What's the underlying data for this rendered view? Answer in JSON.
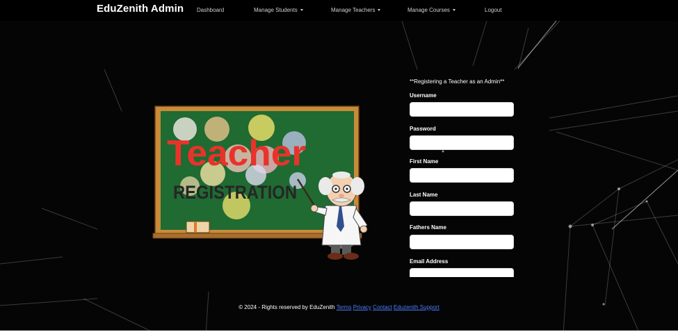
{
  "navbar": {
    "brand": "EduZenith Admin",
    "items": [
      {
        "label": "Dashboard",
        "dropdown": false
      },
      {
        "label": "Manage Students",
        "dropdown": true
      },
      {
        "label": "Manage Teachers",
        "dropdown": true
      },
      {
        "label": "Manage Courses",
        "dropdown": true
      },
      {
        "label": "Logout",
        "dropdown": false
      }
    ]
  },
  "illustration": {
    "title": "Teacher",
    "subtitle": "REGISTRATION"
  },
  "form": {
    "heading": "**Registering a Teacher as an Admin**",
    "fields": [
      {
        "label": "Username",
        "value": ""
      },
      {
        "label": "Password",
        "value": ""
      },
      {
        "label": "First Name",
        "value": ""
      },
      {
        "label": "Last Name",
        "value": ""
      },
      {
        "label": "Fathers Name",
        "value": ""
      },
      {
        "label": "Email Address",
        "value": ""
      }
    ]
  },
  "footer": {
    "copyright": "© 2024 - Rights reserved by EduZenith",
    "links": [
      "Terms",
      "Privacy",
      "Contact",
      "Eduzenith Support"
    ]
  },
  "colors": {
    "background": "#050505",
    "chalkboard": "#1f6b32",
    "board_frame": "#c98a3a",
    "teacher_text": "#e8332b",
    "link": "#4a7fff"
  }
}
